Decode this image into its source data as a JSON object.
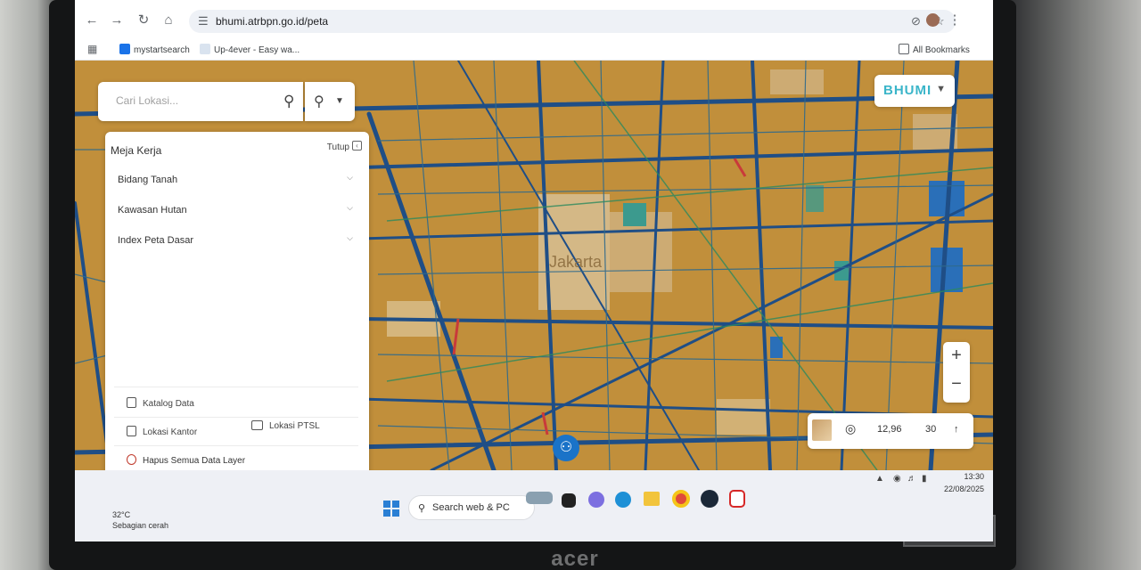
{
  "browser": {
    "url": "bhumi.atrbpn.go.id/peta",
    "bookmarks": [
      "mystartsearch",
      "Up-4ever - Easy wa...",
      "All Bookmarks"
    ],
    "icons": [
      "back-arrow-icon",
      "forward-arrow-icon",
      "reload-icon",
      "home-icon",
      "site-settings-icon",
      "eye-off-icon",
      "star-icon",
      "profile-avatar",
      "menu-dots-icon"
    ]
  },
  "map": {
    "search_placeholder": "Cari Lokasi...",
    "city_label": "Jakarta",
    "logo": "BHUMI",
    "colors": {
      "land": "#c18f3b",
      "roads": "#1f4e86",
      "parcels": "#2f8a76",
      "accent": "#1a73c8"
    }
  },
  "panel": {
    "title": "Meja Kerja",
    "close_label": "Tutup",
    "layers": [
      "Bidang Tanah",
      "Kawasan Hutan",
      "Index Peta Dasar"
    ],
    "actions": {
      "katalog": "Katalog Data",
      "kantor": "Lokasi Kantor",
      "ptsl": "Lokasi PTSL",
      "hapus": "Hapus Semua Data Layer"
    }
  },
  "status": {
    "scale": "12,96",
    "zoom": "30"
  },
  "taskbar": {
    "weather_temp": "32°C",
    "weather_desc": "Sebagian cerah",
    "search": "Search web & PC",
    "time": "13:30",
    "date": "22/08/2025"
  }
}
